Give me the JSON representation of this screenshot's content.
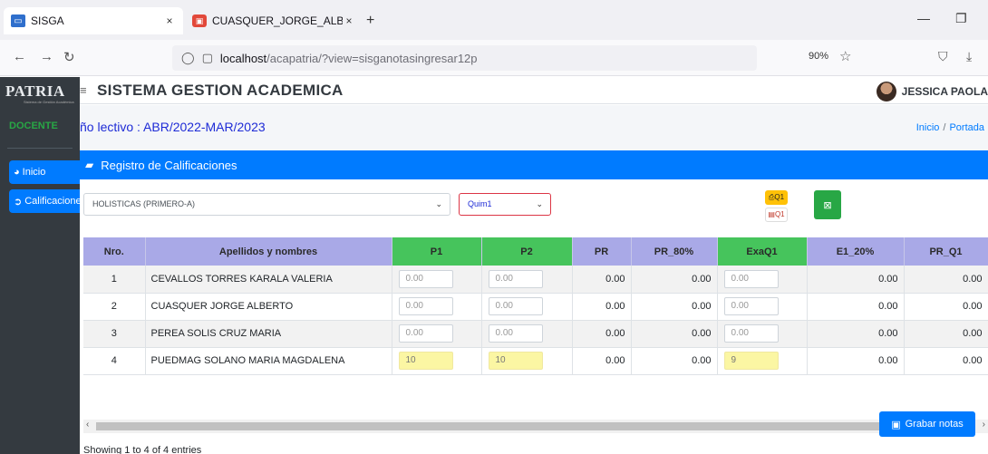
{
  "browser": {
    "tabs": [
      {
        "title": "SISGA",
        "close": "×"
      },
      {
        "title": "CUASQUER_JORGE_ALBERTO.pd",
        "close": "×"
      }
    ],
    "new_tab": "+",
    "url_host": "localhost",
    "url_path": "/acapatria/?view=sisganotasingresar12p",
    "zoom": "90%"
  },
  "app": {
    "brand": "PATRIA",
    "brand_sub": "Sistema de Gestión Académica",
    "title": "SISTEMA GESTION ACADEMICA",
    "user": "JESSICA PAOLA",
    "role": "DOCENTE",
    "nav": [
      {
        "label": "Inicio",
        "icon": "dashboard-icon"
      },
      {
        "label": "Calificaciones",
        "icon": "arrow-circle-right-icon"
      }
    ]
  },
  "content": {
    "period": "ño lectivo : ABR/2022-MAR/2023",
    "breadcrumb": [
      "Inicio",
      "Portada"
    ],
    "card_title": "Registro de Calificaciones",
    "course_select": "HOLISTICAS (PRIMERO-A)",
    "subject_select": "Quim1",
    "pdf_label_1": "Q1",
    "pdf_label_2": "Q1",
    "table": {
      "headers": [
        "Nro.",
        "Apellidos y nombres",
        "P1",
        "P2",
        "PR",
        "PR_80%",
        "ExaQ1",
        "E1_20%",
        "PR_Q1"
      ],
      "rows": [
        {
          "nro": "1",
          "name": "CEVALLOS TORRES KARALA VALERIA",
          "p1": "0.00",
          "p2": "0.00",
          "pr": "0.00",
          "pr80": "0.00",
          "exa": "0.00",
          "e120": "0.00",
          "prq1": "0.00"
        },
        {
          "nro": "2",
          "name": "CUASQUER JORGE ALBERTO",
          "p1": "0.00",
          "p2": "0.00",
          "pr": "0.00",
          "pr80": "0.00",
          "exa": "0.00",
          "e120": "0.00",
          "prq1": "0.00"
        },
        {
          "nro": "3",
          "name": "PEREA SOLIS CRUZ MARIA",
          "p1": "0.00",
          "p2": "0.00",
          "pr": "0.00",
          "pr80": "0.00",
          "exa": "0.00",
          "e120": "0.00",
          "prq1": "0.00"
        },
        {
          "nro": "4",
          "name": "PUEDMAG SOLANO MARIA MAGDALENA",
          "p1": "10",
          "p2": "10",
          "pr": "0.00",
          "pr80": "0.00",
          "exa": "9",
          "e120": "0.00",
          "prq1": "0.00"
        }
      ]
    },
    "showing": "Showing 1 to 4 of 4 entries",
    "save_label": "Grabar notas"
  },
  "colors": {
    "primary": "#007bff",
    "header_purple": "#a9a9e7",
    "header_green": "#46c45c",
    "sidebar": "#343a40",
    "filled_input": "#fbf6a3"
  }
}
